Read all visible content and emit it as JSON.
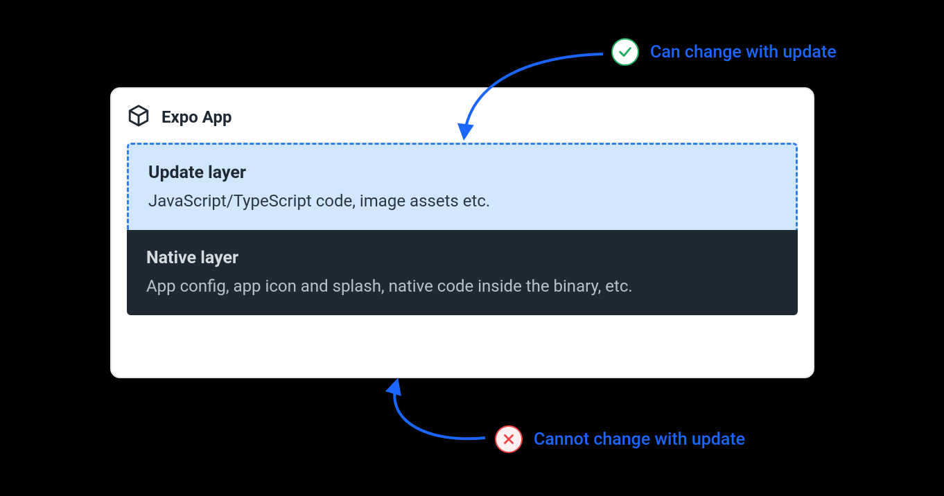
{
  "card": {
    "title": "Expo App",
    "icon_name": "cube-icon"
  },
  "layers": {
    "update": {
      "title": "Update layer",
      "description": "JavaScript/TypeScript code, image assets etc."
    },
    "native": {
      "title": "Native layer",
      "description": "App config, app icon and splash, native code inside the binary, etc."
    }
  },
  "annotations": {
    "can_change": {
      "text": "Can change with update",
      "status": "ok",
      "icon_name": "check-icon"
    },
    "cannot_change": {
      "text": "Cannot change with update",
      "status": "no",
      "icon_name": "cross-icon"
    }
  },
  "colors": {
    "accent_blue": "#1a66ff",
    "dashed_border": "#2f80ed",
    "update_bg": "#d2e6ff",
    "native_bg": "#1f2933",
    "ok_green": "#1aab5c",
    "no_red": "#ef4444"
  }
}
